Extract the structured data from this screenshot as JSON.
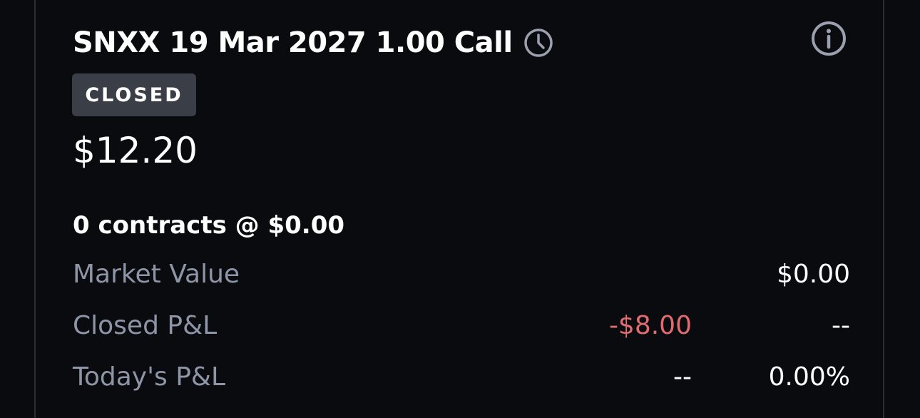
{
  "header": {
    "title": "SNXX 19 Mar 2027 1.00 Call",
    "status": "CLOSED"
  },
  "price": "$12.20",
  "contracts": "0 contracts @ $0.00",
  "rows": [
    {
      "label": "Market Value",
      "mid": "",
      "right": "$0.00"
    },
    {
      "label": "Closed P&L",
      "mid": "-$8.00",
      "right": "--"
    },
    {
      "label": "Today's P&L",
      "mid": "--",
      "right": "0.00%"
    }
  ],
  "colors": {
    "background": "#0a0b0e",
    "badge": "#3a3e47",
    "muted_label": "#8e95a6",
    "negative": "#e06c72",
    "icon": "#9aa0ae"
  },
  "icons": [
    "clock-icon",
    "info-icon"
  ]
}
